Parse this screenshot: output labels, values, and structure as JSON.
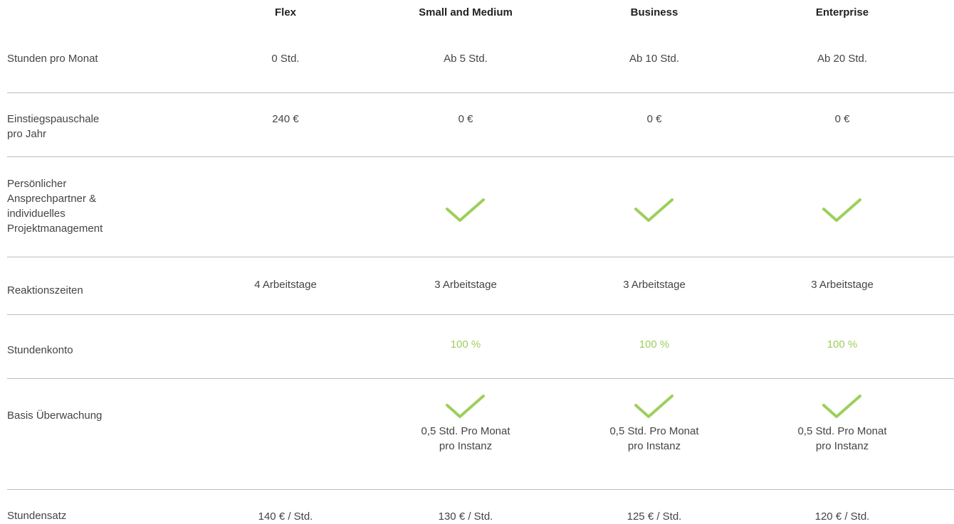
{
  "colors": {
    "accent_green": "#9ccf5b",
    "divider": "#bdbdbd",
    "text": "#444444"
  },
  "header": {
    "plans": [
      "Flex",
      "Small and Medium",
      "Business",
      "Enterprise"
    ]
  },
  "rows": {
    "hours": {
      "label": "Stunden pro Monat",
      "values": [
        "0 Std.",
        "Ab 5 Std.",
        "Ab 10 Std.",
        "Ab 20 Std."
      ]
    },
    "entry_fee": {
      "label_line1": "Einstiegspauschale",
      "label_line2": "pro Jahr",
      "values": [
        "240 €",
        "0 €",
        "0 €",
        "0 €"
      ]
    },
    "contact": {
      "label_line1": "Persönlicher",
      "label_line2": "Ansprechpartner &",
      "label_line3": "individuelles",
      "label_line4": "Projektmanagement",
      "included": [
        false,
        true,
        true,
        true
      ]
    },
    "response": {
      "label": "Reaktionszeiten",
      "values": [
        "4 Arbeitstage",
        "3 Arbeitstage",
        "3 Arbeitstage",
        "3 Arbeitstage"
      ]
    },
    "account": {
      "label": "Stundenkonto",
      "values": [
        "",
        "100 %",
        "100 %",
        "100 %"
      ]
    },
    "monitoring": {
      "label": "Basis Überwachung",
      "included": [
        false,
        true,
        true,
        true
      ],
      "note_line1": "0,5 Std. Pro Monat",
      "note_line2": "pro Instanz"
    },
    "rate": {
      "label": "Stundensatz",
      "values": [
        "140 € / Std.",
        "130 € / Std.",
        "125 € / Std.",
        "120 € / Std."
      ]
    }
  }
}
